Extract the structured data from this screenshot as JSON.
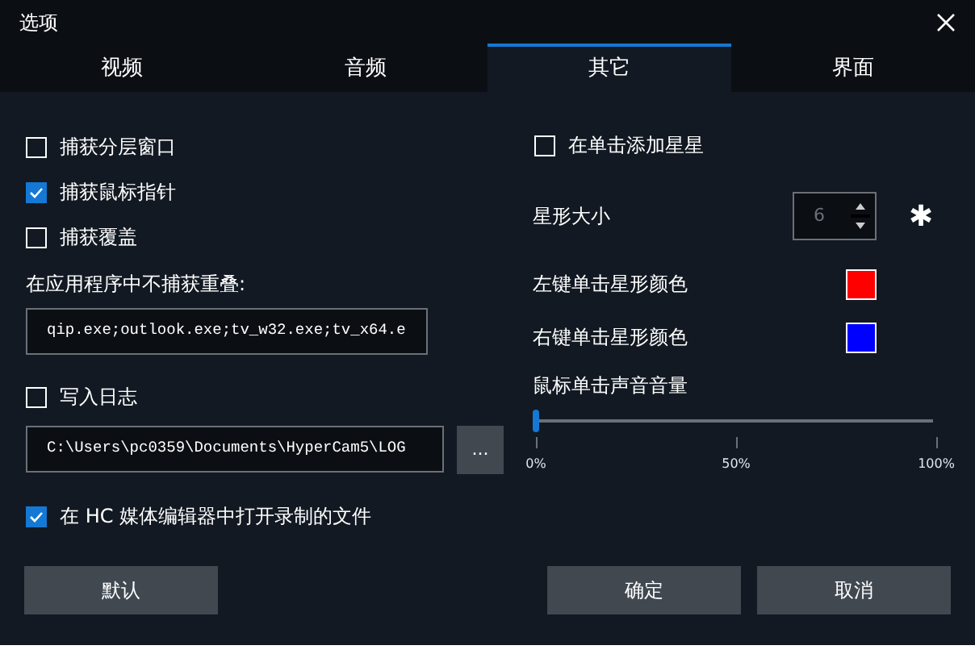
{
  "window": {
    "title": "选项"
  },
  "tabs": [
    {
      "label": "视频",
      "selected": false
    },
    {
      "label": "音频",
      "selected": false
    },
    {
      "label": "其它",
      "selected": true
    },
    {
      "label": "界面",
      "selected": false
    }
  ],
  "capture_options": [
    {
      "label": "捕获分层窗口",
      "checked": false
    },
    {
      "label": "捕获鼠标指针",
      "checked": true
    },
    {
      "label": "捕获覆盖",
      "checked": false
    }
  ],
  "exclude_apps": {
    "label": "在应用程序中不捕获重叠:",
    "value": "qip.exe;outlook.exe;tv_w32.exe;tv_x64.e"
  },
  "write_log": {
    "label": "写入日志",
    "checked": false
  },
  "log_path": {
    "value": "C:\\Users\\pc0359\\Documents\\HyperCam5\\LOG",
    "browse": "..."
  },
  "open_in_editor": {
    "label": "在 HC 媒体编辑器中打开录制的文件",
    "checked": true
  },
  "add_stars": {
    "label": "在单击添加星星",
    "checked": false
  },
  "star_size": {
    "label": "星形大小",
    "value": "6",
    "symbol": "✱"
  },
  "star_colors": [
    {
      "label": "左键单击星形颜色",
      "color": "#ff0000"
    },
    {
      "label": "右键单击星形颜色",
      "color": "#0000ff"
    }
  ],
  "click_volume": {
    "label": "鼠标单击声音音量",
    "level": 0,
    "ticks": [
      "0%",
      "50%",
      "100%"
    ]
  },
  "buttons": {
    "default": "默认",
    "ok": "确定",
    "cancel": "取消"
  }
}
